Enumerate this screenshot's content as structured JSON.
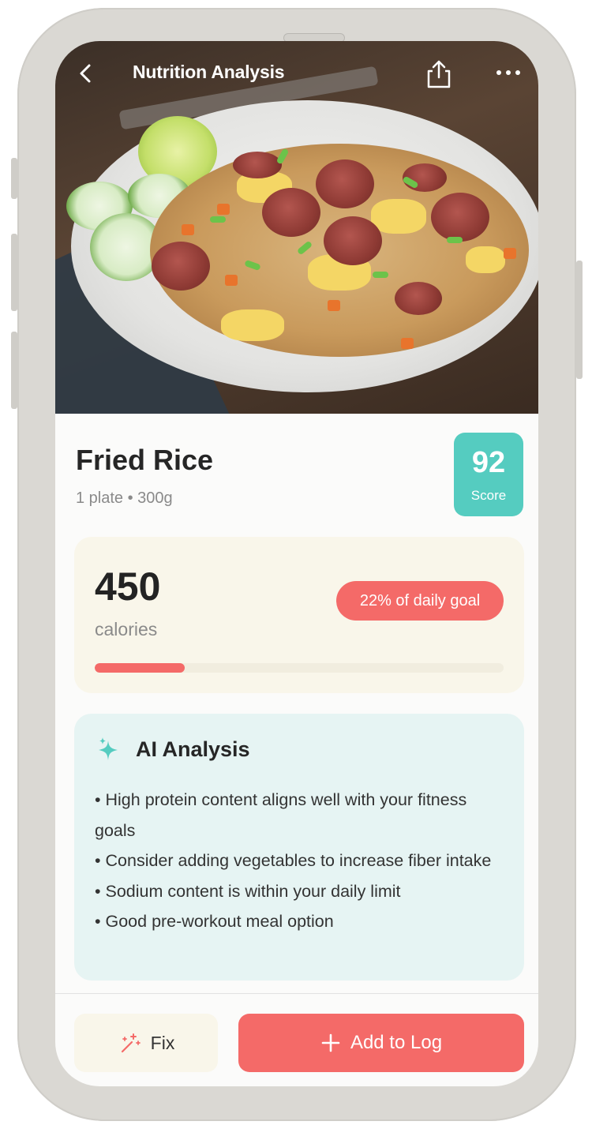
{
  "header": {
    "title": "Nutrition Analysis",
    "back_icon": "chevron-left",
    "share_icon": "share",
    "more_icon": "more-horizontal"
  },
  "food": {
    "name": "Fried Rice",
    "portion": "1 plate • 300g",
    "score_value": "92",
    "score_label": "Score"
  },
  "calories": {
    "value": "450",
    "label": "calories",
    "goal_text": "22% of daily goal",
    "progress_fraction": 0.22
  },
  "ai": {
    "title": "AI Analysis",
    "icon": "sparkles",
    "points": [
      "• High protein content aligns well with your fitness goals",
      "• Consider adding vegetables to increase fiber intake",
      "• Sodium content is within your daily limit",
      "• Good pre-workout meal option"
    ]
  },
  "actions": {
    "fix_label": "Fix",
    "fix_icon": "magic-wand",
    "add_label": "Add to Log",
    "add_icon": "plus"
  },
  "colors": {
    "accent": "#f46a68",
    "score": "#55ccc0",
    "ai_card": "#e6f4f3",
    "calorie_card": "#f9f6ea"
  }
}
